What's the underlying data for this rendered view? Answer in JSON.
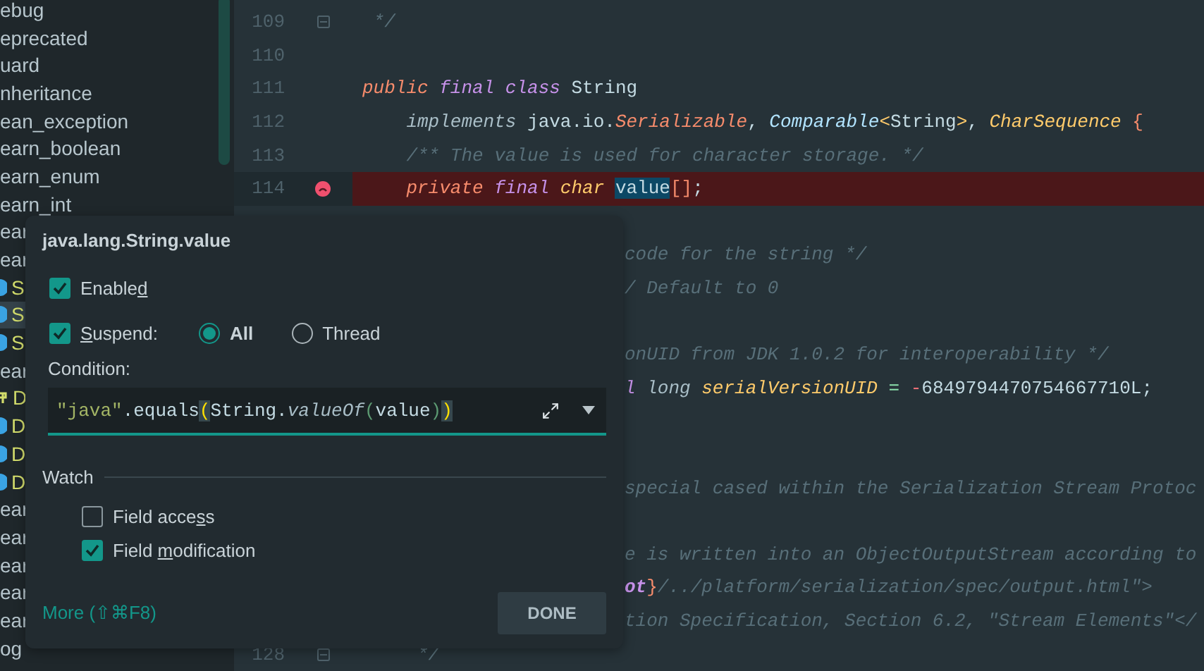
{
  "sidebar": {
    "items": [
      {
        "text": "ebug",
        "kind": "plain",
        "selected": false
      },
      {
        "text": "eprecated",
        "kind": "plain",
        "selected": false
      },
      {
        "text": "uard",
        "kind": "plain",
        "selected": false
      },
      {
        "text": "nheritance",
        "kind": "plain",
        "selected": false
      },
      {
        "text": "ean_exception",
        "kind": "plain",
        "selected": false
      },
      {
        "text": "earn_boolean",
        "kind": "plain",
        "selected": false
      },
      {
        "text": "earn_enum",
        "kind": "plain",
        "selected": false
      },
      {
        "text": "earn_int",
        "kind": "plain",
        "selected": false
      },
      {
        "text": "ear",
        "kind": "plain",
        "selected": false
      },
      {
        "text": "ear",
        "kind": "plain",
        "selected": false
      },
      {
        "text": "S",
        "kind": "class",
        "selected": false
      },
      {
        "text": "S",
        "kind": "class",
        "selected": true
      },
      {
        "text": "S",
        "kind": "class",
        "selected": false
      },
      {
        "text": "ear",
        "kind": "plain",
        "selected": false
      },
      {
        "text": "D",
        "kind": "package",
        "selected": false
      },
      {
        "text": "D",
        "kind": "class",
        "selected": false
      },
      {
        "text": "D",
        "kind": "class",
        "selected": false
      },
      {
        "text": "D",
        "kind": "class",
        "selected": false
      },
      {
        "text": "ear",
        "kind": "plain",
        "selected": false
      },
      {
        "text": "ear",
        "kind": "plain",
        "selected": false
      },
      {
        "text": "ear",
        "kind": "plain",
        "selected": false
      },
      {
        "text": "ear",
        "kind": "plain",
        "selected": false
      },
      {
        "text": "ear",
        "kind": "plain",
        "selected": false
      },
      {
        "text": "og",
        "kind": "plain",
        "selected": false
      }
    ]
  },
  "editor": {
    "lines": [
      {
        "number": "109",
        "kind": "full",
        "fold": true,
        "breakpoint": false,
        "segments": [
          {
            "text": " */",
            "kind": "comment"
          }
        ]
      },
      {
        "number": "110",
        "kind": "full",
        "fold": false,
        "breakpoint": false
      },
      {
        "number": "111",
        "kind": "full",
        "fold": false,
        "breakpoint": false,
        "segments": [
          {
            "text": "public",
            "kind": "modifier"
          },
          {
            "text": " final",
            "kind": "keyword"
          },
          {
            "text": " class",
            "kind": "keyword"
          },
          {
            "text": " String",
            "kind": "plain"
          }
        ]
      },
      {
        "number": "112",
        "kind": "indented",
        "fold": false,
        "breakpoint": false,
        "segments": [
          {
            "text": "implements",
            "kind": "italic"
          },
          {
            "text": " java.io.",
            "kind": "plain"
          },
          {
            "text": "Serializable",
            "kind": "modifier"
          },
          {
            "text": ", ",
            "kind": "plain"
          },
          {
            "text": "Comparable",
            "kind": "interface"
          },
          {
            "text": "<",
            "kind": "bracket"
          },
          {
            "text": "String",
            "kind": "plain"
          },
          {
            "text": ">",
            "kind": "bracket"
          },
          {
            "text": ", ",
            "kind": "plain"
          },
          {
            "text": "CharSequence",
            "kind": "type"
          },
          {
            "text": " {",
            "kind": "brace"
          }
        ]
      },
      {
        "number": "113",
        "kind": "indented",
        "fold": false,
        "breakpoint": false,
        "segments": [
          {
            "text": "/** The value is used for character storage. */",
            "kind": "comment"
          }
        ]
      },
      {
        "number": "114",
        "kind": "indented",
        "fold": false,
        "breakpoint": true,
        "segments": [
          {
            "text": "private",
            "kind": "modifier"
          },
          {
            "text": " final",
            "kind": "keyword"
          },
          {
            "text": " char ",
            "kind": "type"
          },
          {
            "text": "value",
            "kind": "occurrence"
          },
          {
            "text": "[]",
            "kind": "brace"
          },
          {
            "text": ";",
            "kind": "plain"
          }
        ]
      },
      {
        "kind": "partial"
      },
      {
        "kind": "partial",
        "segments": [
          {
            "text": "code for the string */",
            "kind": "comment"
          }
        ]
      },
      {
        "kind": "partial",
        "segments": [
          {
            "text": "/ Default to 0",
            "kind": "comment"
          }
        ]
      },
      {
        "kind": "partial"
      },
      {
        "kind": "partial",
        "segments": [
          {
            "text": "onUID from JDK 1.0.2 for interoperability */",
            "kind": "comment"
          }
        ]
      },
      {
        "kind": "partial",
        "segments": [
          {
            "text": "l",
            "kind": "keyword"
          },
          {
            "text": " long ",
            "kind": "italic"
          },
          {
            "text": "serialVersionUID",
            "kind": "type"
          },
          {
            "text": " = ",
            "kind": "operator"
          },
          {
            "text": "-",
            "kind": "negative"
          },
          {
            "text": "6849794470754667710L;",
            "kind": "plain"
          }
        ]
      },
      {
        "kind": "partial"
      },
      {
        "kind": "partial"
      },
      {
        "kind": "partial",
        "segments": [
          {
            "text": "special cased within the Serialization Stream Protoc",
            "kind": "comment"
          }
        ]
      },
      {
        "kind": "partial"
      },
      {
        "kind": "partial",
        "segments": [
          {
            "text": "e is written into an ObjectOutputStream according to",
            "kind": "comment"
          }
        ]
      },
      {
        "kind": "partial",
        "segments": [
          {
            "text": "ot",
            "kind": "tag"
          },
          {
            "text": "}",
            "kind": "brace"
          },
          {
            "text": "/../platform/serialization/spec/output.html\">",
            "kind": "comment"
          }
        ]
      },
      {
        "kind": "partial",
        "segments": [
          {
            "text": "tion Specification, Section 6.2, \"Stream Elements\"</",
            "kind": "comment"
          }
        ]
      },
      {
        "number": "128",
        "kind": "full",
        "fold": true,
        "breakpoint": false,
        "segments": [
          {
            "text": "     */",
            "kind": "comment"
          }
        ]
      }
    ]
  },
  "popup": {
    "title": "java.lang.String.value",
    "enabled": {
      "label": [
        {
          "text": "Enable",
          "underlined": false
        },
        {
          "text": "d",
          "underlined": true
        }
      ],
      "checked": true
    },
    "suspend": {
      "label": [
        {
          "text": "S",
          "underlined": true
        },
        {
          "text": "uspend:",
          "underlined": false
        }
      ],
      "checked": true,
      "options": [
        {
          "label": "All",
          "selected": true
        },
        {
          "label": "Thread",
          "selected": false
        }
      ]
    },
    "condition": {
      "label": "Condition:",
      "segments": [
        {
          "text": "\"java\"",
          "kind": "string"
        },
        {
          "text": ".equals",
          "kind": "plain"
        },
        {
          "text": "(",
          "kind": "match"
        },
        {
          "text": "String.",
          "kind": "plain"
        },
        {
          "text": "valueOf",
          "kind": "italic"
        },
        {
          "text": "(",
          "kind": "paren"
        },
        {
          "text": "value",
          "kind": "plain"
        },
        {
          "text": ")",
          "kind": "paren"
        },
        {
          "text": ")",
          "kind": "match"
        }
      ]
    },
    "watch": {
      "title": "Watch",
      "options": [
        {
          "label": [
            {
              "text": "Field acce",
              "underlined": false
            },
            {
              "text": "s",
              "underlined": true
            },
            {
              "text": "s",
              "underlined": false
            }
          ],
          "checked": false
        },
        {
          "label": [
            {
              "text": "Field ",
              "underlined": false
            },
            {
              "text": "m",
              "underlined": true
            },
            {
              "text": "odification",
              "underlined": false
            }
          ],
          "checked": true
        }
      ]
    },
    "more_link": "More (⇧⌘F8)",
    "done_button": "DONE"
  }
}
